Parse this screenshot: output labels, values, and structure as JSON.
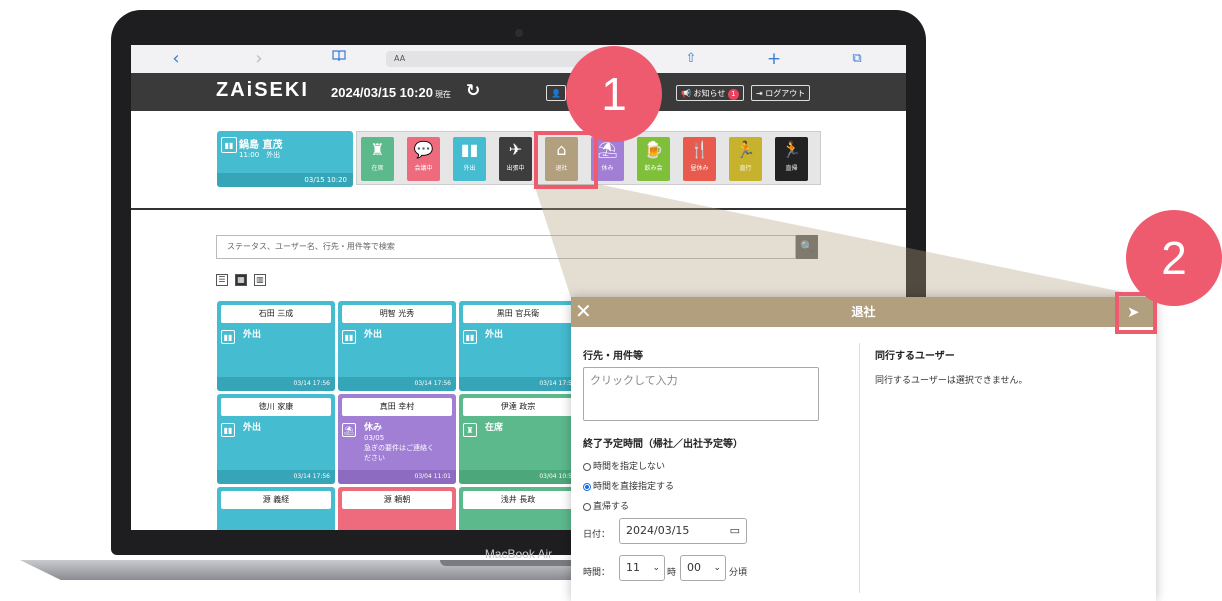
{
  "laptop": {
    "model_label": "MacBook Air"
  },
  "browser": {
    "back": "‹",
    "forward": "›",
    "bookmarks": "📖",
    "address": "AA",
    "share": "⇧",
    "new_tab": "+",
    "tabs": "⧉"
  },
  "app": {
    "logo": "ZAiSEKI",
    "datetime": "2024/03/15 10:20",
    "datetime_suffix": "現在",
    "refresh": "↻",
    "header_buttons": {
      "user": "👤",
      "notice": "お知らせ",
      "notice_count": "1",
      "logout": "ログアウト"
    }
  },
  "my_status": {
    "name": "鍋島 直茂",
    "time": "11:00",
    "status": "外出",
    "updated": "03/15 10:20"
  },
  "status_buttons": [
    {
      "label": "在席",
      "icon": "seat-icon",
      "glyph": "♜",
      "color": "#5bb98c"
    },
    {
      "label": "会議中",
      "icon": "chat-icon",
      "glyph": "💬",
      "color": "#ee6b7e"
    },
    {
      "label": "外出",
      "icon": "walk-icon",
      "glyph": "👣",
      "color": "#45bcd0"
    },
    {
      "label": "出張中",
      "icon": "plane-icon",
      "glyph": "✈",
      "color": "#3d3d3d"
    },
    {
      "label": "退社",
      "icon": "home-icon",
      "glyph": "⌂",
      "color": "#b29f7e"
    },
    {
      "label": "休み",
      "icon": "beach-icon",
      "glyph": "⛱",
      "color": "#a07fd4"
    },
    {
      "label": "飲み会",
      "icon": "beer-icon",
      "glyph": "🍺",
      "color": "#7fbf3a"
    },
    {
      "label": "昼休み",
      "icon": "meal-icon",
      "glyph": "🍴",
      "color": "#e75a4d"
    },
    {
      "label": "直行",
      "icon": "run-icon",
      "glyph": "🏃",
      "color": "#c6b22c"
    },
    {
      "label": "直帰",
      "icon": "run-home-icon",
      "glyph": "🏃",
      "color": "#222222"
    }
  ],
  "search": {
    "placeholder": "ステータス、ユーザー名、行先・用件等で検索",
    "button": "🔍"
  },
  "view_buttons": [
    "☰",
    "▦",
    "▥"
  ],
  "users": [
    {
      "name": "石田 三成",
      "status": "外出",
      "updated": "03/14 17:56",
      "color": "#45bcd0",
      "foot": "#37a5b8"
    },
    {
      "name": "明智 光秀",
      "status": "外出",
      "updated": "03/14 17:56",
      "color": "#45bcd0",
      "foot": "#37a5b8"
    },
    {
      "name": "黒田 官兵衛",
      "status": "外出",
      "updated": "03/14 17:5",
      "color": "#45bcd0",
      "foot": "#37a5b8"
    },
    {
      "name": "徳川 家康",
      "status": "外出",
      "updated": "03/14 17:56",
      "color": "#45bcd0",
      "foot": "#37a5b8"
    },
    {
      "name": "真田 幸村",
      "status": "休み",
      "detail1": "03/05",
      "detail2": "急ぎの要件はご連絡く",
      "detail3": "ださい",
      "updated": "03/04 11:01",
      "color": "#a07fd4",
      "foot": "#8c6bc0"
    },
    {
      "name": "伊達 政宗",
      "status": "在席",
      "updated": "03/04 10:5",
      "color": "#5bb98c",
      "foot": "#4ca77a"
    },
    {
      "name": "源 義経",
      "status": "",
      "updated": "",
      "color": "#45bcd0",
      "foot": "#37a5b8"
    },
    {
      "name": "源 頼朝",
      "status": "",
      "updated": "",
      "color": "#ee6b7e",
      "foot": "#d8596c"
    },
    {
      "name": "浅井 長政",
      "status": "",
      "updated": "",
      "color": "#5bb98c",
      "foot": "#4ca77a"
    }
  ],
  "callouts": {
    "one": "1",
    "two": "2",
    "accent": "#ee5b6f"
  },
  "dialog": {
    "close": "✕",
    "title": "退社",
    "send": "➤",
    "destination_label": "行先・用件等",
    "destination_placeholder": "クリックして入力",
    "end_time_label": "終了予定時間（帰社／出社予定等）",
    "options": [
      "時間を指定しない",
      "時間を直接指定する",
      "直帰する"
    ],
    "selected_option": "時間を直接指定する",
    "date_label": "日付：",
    "date_value": "2024/03/15",
    "time_label": "時間：",
    "hour_value": "11",
    "hour_unit": "時",
    "minute_value": "00",
    "minute_unit": "分頃",
    "companion_label": "同行するユーザー",
    "companion_text": "同行するユーザーは選択できません。"
  }
}
